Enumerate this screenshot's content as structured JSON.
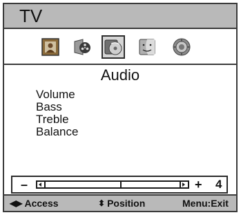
{
  "window": {
    "title": "TV"
  },
  "menu_icons": [
    {
      "name": "picture-icon",
      "selected": false
    },
    {
      "name": "channel-icon",
      "selected": false
    },
    {
      "name": "audio-icon",
      "selected": true
    },
    {
      "name": "time-icon",
      "selected": false
    },
    {
      "name": "setup-icon",
      "selected": false
    }
  ],
  "section": {
    "title": "Audio"
  },
  "audio_items": [
    "Volume",
    "Bass",
    "Treble",
    "Balance"
  ],
  "slider": {
    "minus_label": "–",
    "plus_label": "+",
    "value": "4",
    "level": 0.56
  },
  "footer": {
    "access": {
      "icon": "left-right-arrows-icon",
      "label": "Access"
    },
    "position": {
      "icon": "up-down-arrows-icon",
      "label": "Position"
    },
    "exit": {
      "label": "Menu:Exit"
    }
  },
  "colors": {
    "bar_gray": "#b9b9b9",
    "selected_bg": "#d6d6d6",
    "border": "#3a3a3a"
  }
}
